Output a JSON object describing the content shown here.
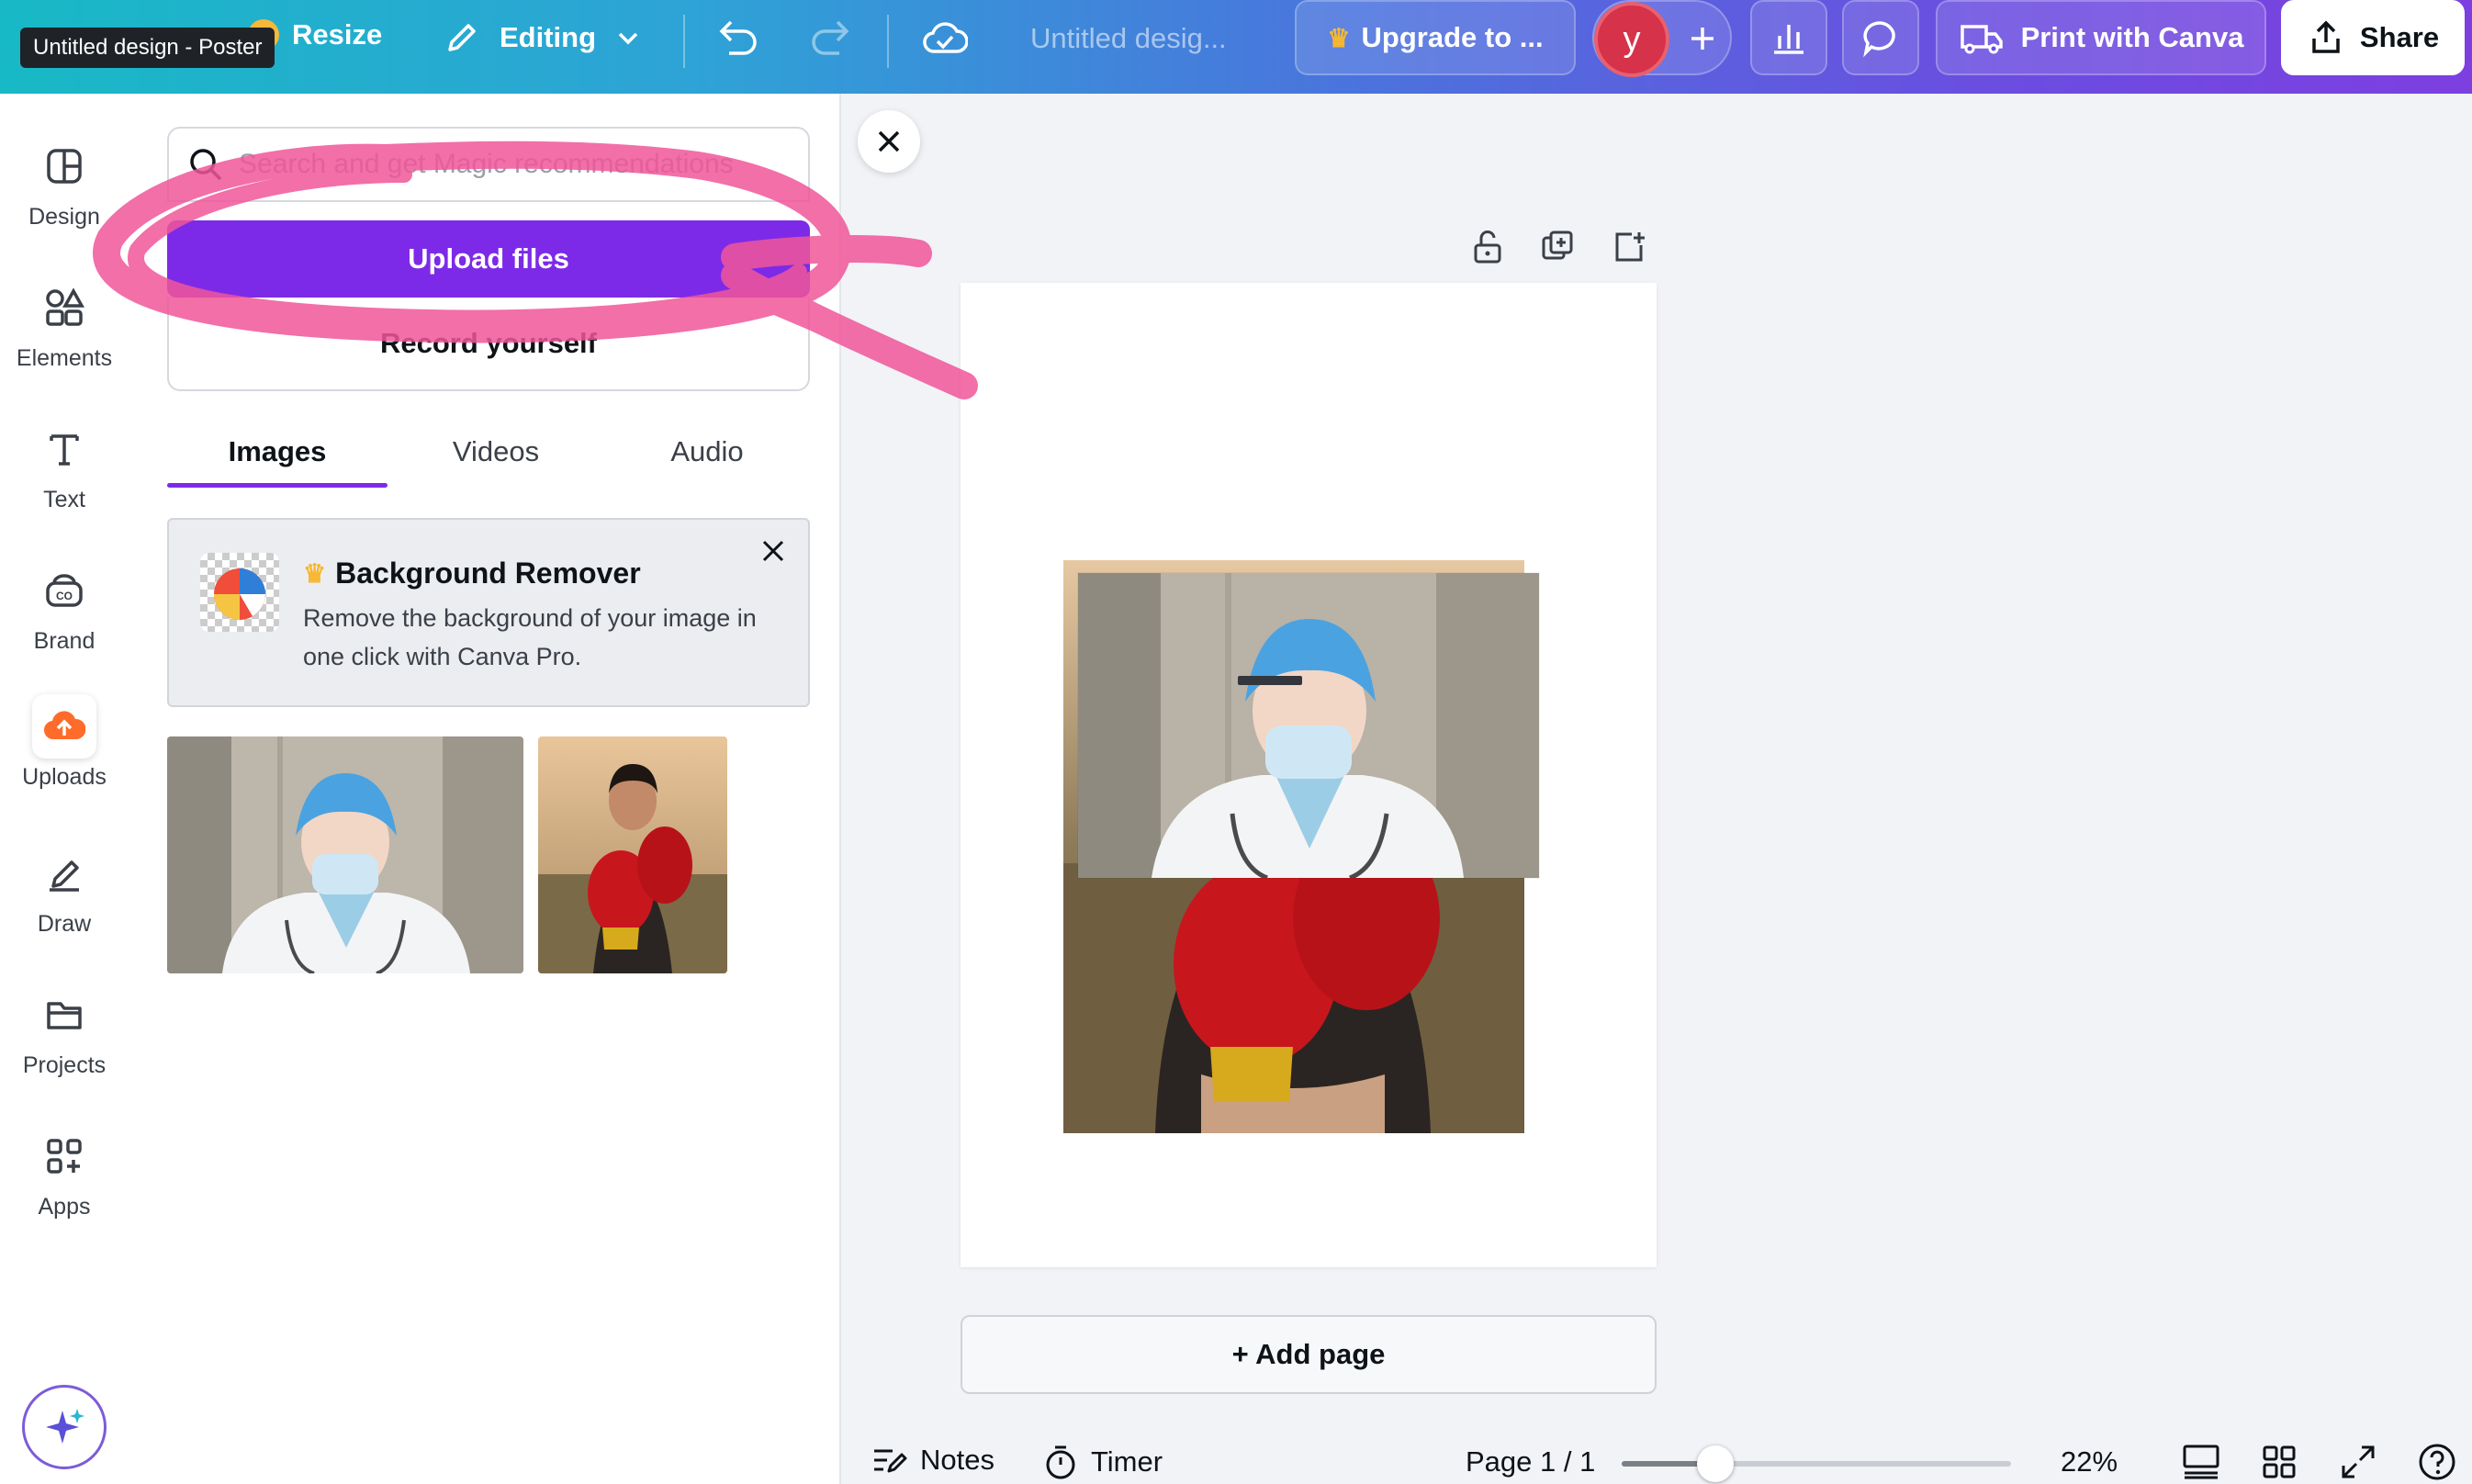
{
  "topbar": {
    "tooltip": "Untitled design - Poster",
    "resize_label": "Resize",
    "editing_label": "Editing",
    "design_title": "Untitled desig...",
    "upgrade_label": "Upgrade to ...",
    "avatar_initial": "y",
    "print_label": "Print with Canva",
    "share_label": "Share"
  },
  "leftnav": {
    "items": [
      {
        "label": "Design",
        "icon": "design-icon"
      },
      {
        "label": "Elements",
        "icon": "elements-icon"
      },
      {
        "label": "Text",
        "icon": "text-icon"
      },
      {
        "label": "Brand",
        "icon": "brand-icon"
      },
      {
        "label": "Uploads",
        "icon": "upload-cloud-icon"
      },
      {
        "label": "Draw",
        "icon": "draw-icon"
      },
      {
        "label": "Projects",
        "icon": "folder-icon"
      },
      {
        "label": "Apps",
        "icon": "apps-icon"
      }
    ]
  },
  "panel": {
    "search_placeholder": "Search and get Magic recommendations",
    "upload_label": "Upload files",
    "record_label": "Record yourself",
    "tabs": [
      {
        "label": "Images"
      },
      {
        "label": "Videos"
      },
      {
        "label": "Audio"
      }
    ],
    "promo": {
      "title": "Background Remover",
      "description": "Remove the background of your image in one click with Canva Pro."
    }
  },
  "canvas": {
    "add_page_label": "+ Add page"
  },
  "bottombar": {
    "notes_label": "Notes",
    "timer_label": "Timer",
    "page_indicator": "Page 1 / 1",
    "zoom_label": "22%",
    "zoom_fraction": 0.24
  },
  "colors": {
    "accent": "#7d2ae8",
    "scribble": "#f0569a",
    "upload_orange": "#ff6b2b"
  }
}
